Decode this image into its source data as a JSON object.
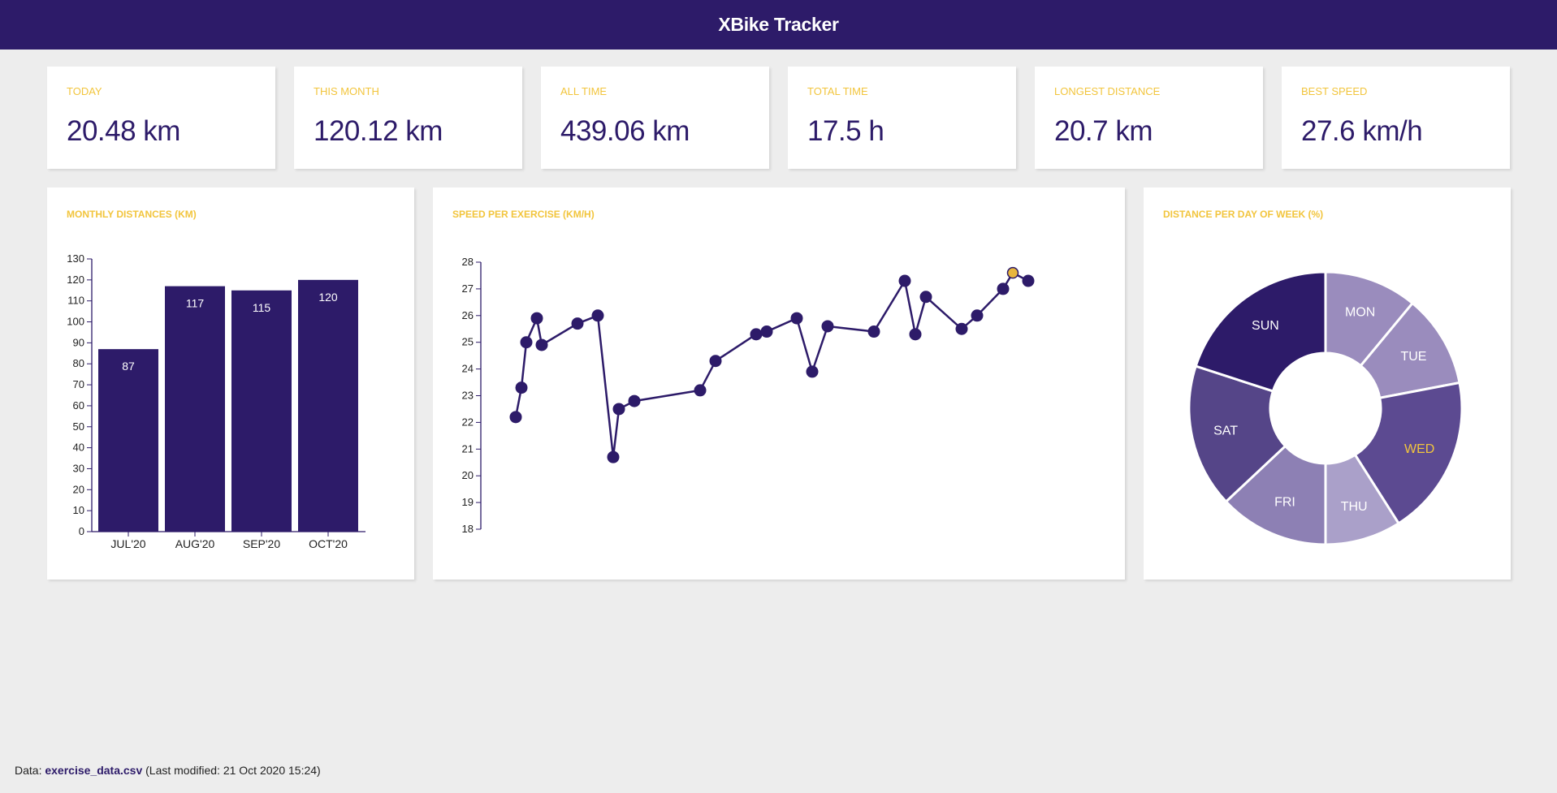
{
  "app": {
    "title": "XBike Tracker"
  },
  "stats": [
    {
      "label": "TODAY",
      "value": "20.48 km"
    },
    {
      "label": "THIS MONTH",
      "value": "120.12 km"
    },
    {
      "label": "ALL TIME",
      "value": "439.06 km"
    },
    {
      "label": "TOTAL TIME",
      "value": "17.5 h"
    },
    {
      "label": "LONGEST DISTANCE",
      "value": "20.7 km"
    },
    {
      "label": "BEST SPEED",
      "value": "27.6 km/h"
    }
  ],
  "panels": {
    "monthly": {
      "title": "MONTHLY DISTANCES (KM)"
    },
    "speed": {
      "title": "SPEED PER EXERCISE (KM/H)"
    },
    "weekday": {
      "title": "DISTANCE PER DAY OF WEEK (%)"
    }
  },
  "colors": {
    "primary": "#2d1b69",
    "accent": "#f2c53d",
    "highlight_point": "#e8b63c"
  },
  "chart_data": [
    {
      "type": "bar",
      "categories": [
        "JUL'20",
        "AUG'20",
        "SEP'20",
        "OCT'20"
      ],
      "values": [
        87,
        117,
        115,
        120
      ],
      "ylim": [
        0,
        130
      ],
      "yticks": [
        0,
        10,
        20,
        30,
        40,
        50,
        60,
        70,
        80,
        90,
        100,
        110,
        120,
        130
      ]
    },
    {
      "type": "line",
      "y": [
        22.2,
        23.3,
        25.0,
        25.9,
        24.9,
        25.7,
        26.0,
        20.7,
        22.5,
        22.8,
        23.2,
        24.3,
        25.3,
        25.4,
        25.9,
        23.9,
        25.6,
        25.4,
        27.3,
        25.3,
        26.7,
        25.5,
        26.0,
        27.0,
        27.6,
        27.3
      ],
      "highlight_index": 24,
      "ylim": [
        18,
        28
      ],
      "yticks": [
        18,
        19,
        20,
        21,
        22,
        23,
        24,
        25,
        26,
        27,
        28
      ]
    },
    {
      "type": "pie",
      "labels": [
        "MON",
        "TUE",
        "WED",
        "THU",
        "FRI",
        "SAT",
        "SUN"
      ],
      "values": [
        11,
        11,
        19,
        9,
        13,
        17,
        20
      ],
      "highlight_label": "WED",
      "colors": [
        "#9a8cbd",
        "#9a8cbd",
        "#5c4a91",
        "#aaa0c9",
        "#8d80b4",
        "#554588",
        "#2d1b69"
      ]
    }
  ],
  "footer": {
    "prefix": "Data: ",
    "file": "exercise_data.csv",
    "modified": " (Last modified: 21 Oct 2020 15:24)"
  }
}
